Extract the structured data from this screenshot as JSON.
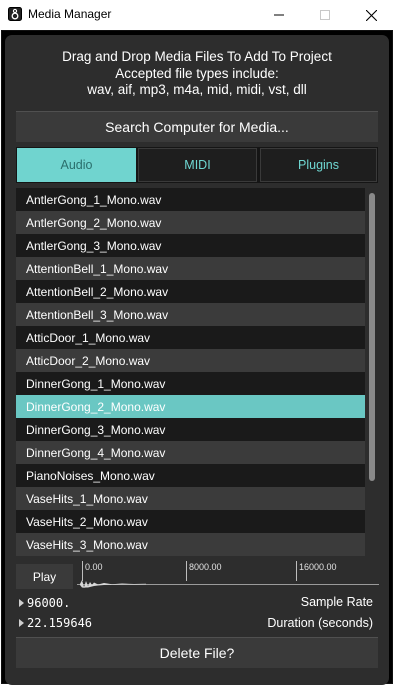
{
  "window": {
    "title": "Media Manager",
    "minimize": "—",
    "maximize": "☐",
    "close": "✕"
  },
  "instructions": {
    "line1": "Drag and Drop Media Files To Add To Project",
    "line2": "Accepted file types include:",
    "line3": "wav, aif, mp3, m4a, mid, midi, vst, dll"
  },
  "search_label": "Search Computer for Media...",
  "tabs": [
    {
      "label": "Audio",
      "active": true
    },
    {
      "label": "MIDI",
      "active": false
    },
    {
      "label": "Plugins",
      "active": false
    }
  ],
  "files": [
    "AntlerGong_1_Mono.wav",
    "AntlerGong_2_Mono.wav",
    "AntlerGong_3_Mono.wav",
    "AttentionBell_1_Mono.wav",
    "AttentionBell_2_Mono.wav",
    "AttentionBell_3_Mono.wav",
    "AtticDoor_1_Mono.wav",
    "AtticDoor_2_Mono.wav",
    "DinnerGong_1_Mono.wav",
    "DinnerGong_2_Mono.wav",
    "DinnerGong_3_Mono.wav",
    "DinnerGong_4_Mono.wav",
    "PianoNoises_Mono.wav",
    "VaseHits_1_Mono.wav",
    "VaseHits_2_Mono.wav",
    "VaseHits_3_Mono.wav"
  ],
  "selected_file": "DinnerGong_2_Mono.wav",
  "player": {
    "play_label": "Play",
    "ticks": [
      "0.00",
      "8000.00",
      "16000.00"
    ]
  },
  "sample_rate": {
    "value": "96000.",
    "label": "Sample Rate"
  },
  "duration": {
    "value": "22.159646",
    "label": "Duration (seconds)"
  },
  "delete_label": "Delete File?",
  "colors": {
    "accent": "#70d4cf",
    "panel": "#2d2d2d",
    "row_dark": "#1a1a1a",
    "row_light": "#3b3b3b"
  }
}
